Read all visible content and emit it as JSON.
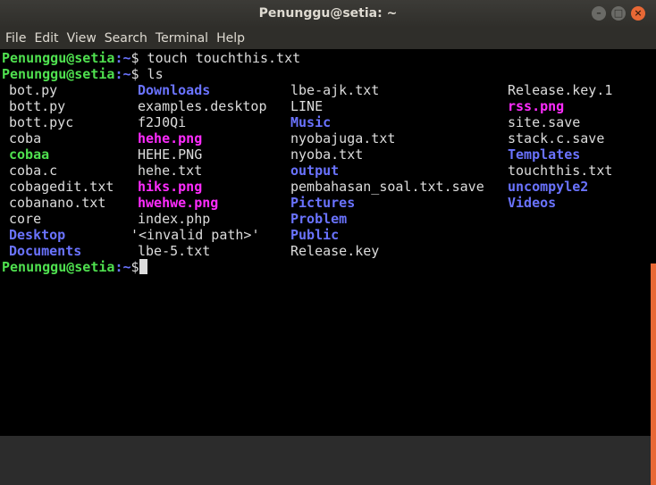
{
  "window": {
    "title": "Penunggu@setia: ~"
  },
  "menubar": [
    "File",
    "Edit",
    "View",
    "Search",
    "Terminal",
    "Help"
  ],
  "prompt": {
    "user": "Penunggu@setia",
    "path": ":~",
    "symbol": "$"
  },
  "commands": [
    " touch touchthis.txt",
    " ls"
  ],
  "listing": {
    "columns": [
      [
        {
          "name": "bot.py",
          "type": "file"
        },
        {
          "name": "bott.py",
          "type": "file"
        },
        {
          "name": "bott.pyc",
          "type": "file"
        },
        {
          "name": "coba",
          "type": "file"
        },
        {
          "name": "cobaa",
          "type": "exe"
        },
        {
          "name": "coba.c",
          "type": "file"
        },
        {
          "name": "cobagedit.txt",
          "type": "file"
        },
        {
          "name": "cobanano.txt",
          "type": "file"
        },
        {
          "name": "core",
          "type": "file"
        },
        {
          "name": "Desktop",
          "type": "dir"
        },
        {
          "name": "Documents",
          "type": "dir"
        }
      ],
      [
        {
          "name": "Downloads",
          "type": "dir"
        },
        {
          "name": "examples.desktop",
          "type": "file"
        },
        {
          "name": "f2J0Qi",
          "type": "file"
        },
        {
          "name": "hehe.png",
          "type": "img"
        },
        {
          "name": "HEHE.PNG",
          "type": "file"
        },
        {
          "name": "hehe.txt",
          "type": "file"
        },
        {
          "name": "hiks.png",
          "type": "img"
        },
        {
          "name": "hwehwe.png",
          "type": "img"
        },
        {
          "name": "index.php",
          "type": "file"
        },
        {
          "name": "'<invalid path>'",
          "type": "file"
        },
        {
          "name": "lbe-5.txt",
          "type": "file"
        }
      ],
      [
        {
          "name": "lbe-ajk.txt",
          "type": "file"
        },
        {
          "name": "LINE",
          "type": "file"
        },
        {
          "name": "Music",
          "type": "dir"
        },
        {
          "name": "nyobajuga.txt",
          "type": "file"
        },
        {
          "name": "nyoba.txt",
          "type": "file"
        },
        {
          "name": "output",
          "type": "dir"
        },
        {
          "name": "pembahasan_soal.txt.save",
          "type": "file"
        },
        {
          "name": "Pictures",
          "type": "dir"
        },
        {
          "name": "Problem",
          "type": "dir"
        },
        {
          "name": "Public",
          "type": "dir"
        },
        {
          "name": "Release.key",
          "type": "file"
        }
      ],
      [
        {
          "name": "Release.key.1",
          "type": "file"
        },
        {
          "name": "rss.png",
          "type": "img"
        },
        {
          "name": "site.save",
          "type": "file"
        },
        {
          "name": "stack.c.save",
          "type": "file"
        },
        {
          "name": "Templates",
          "type": "dir"
        },
        {
          "name": "touchthis.txt",
          "type": "file"
        },
        {
          "name": "uncompyle2",
          "type": "dir"
        },
        {
          "name": "Videos",
          "type": "dir"
        }
      ]
    ]
  },
  "colors": {
    "dir": "#6a73ff",
    "img": "#ff2cff",
    "exe": "#4fe04f",
    "file": "#dcdcdc",
    "prompt_user": "#4fe04f",
    "accent": "#e86835"
  }
}
